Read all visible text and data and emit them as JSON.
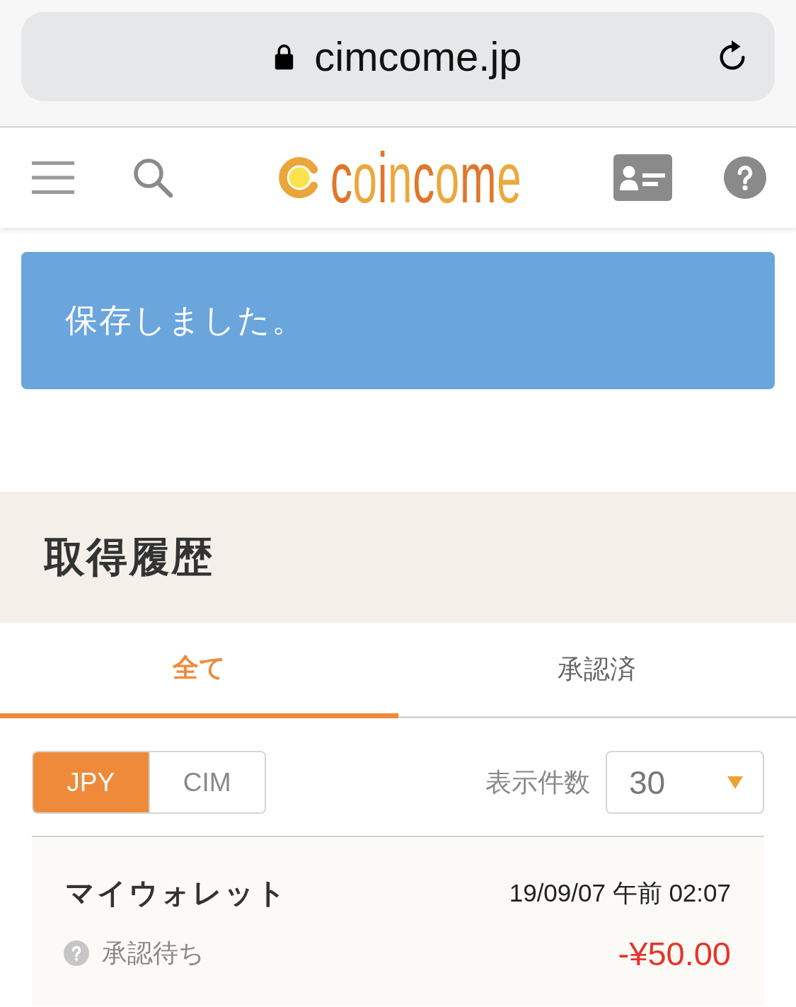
{
  "browser_bar": {
    "url": "cimcome.jp"
  },
  "header": {
    "logo": "coincome"
  },
  "alert": {
    "message": "保存しました。"
  },
  "section": {
    "title": "取得履歴"
  },
  "tabs": [
    {
      "label": "全て",
      "selected": true
    },
    {
      "label": "承認済",
      "selected": false
    }
  ],
  "currency_toggle": [
    {
      "label": "JPY",
      "selected": true
    },
    {
      "label": "CIM",
      "selected": false
    }
  ],
  "per_page": {
    "label": "表示件数",
    "value": "30"
  },
  "history": [
    {
      "source": "マイウォレット",
      "datetime": "19/09/07 午前 02:07",
      "status": "承認待ち",
      "amount": "-¥50.00"
    }
  ]
}
